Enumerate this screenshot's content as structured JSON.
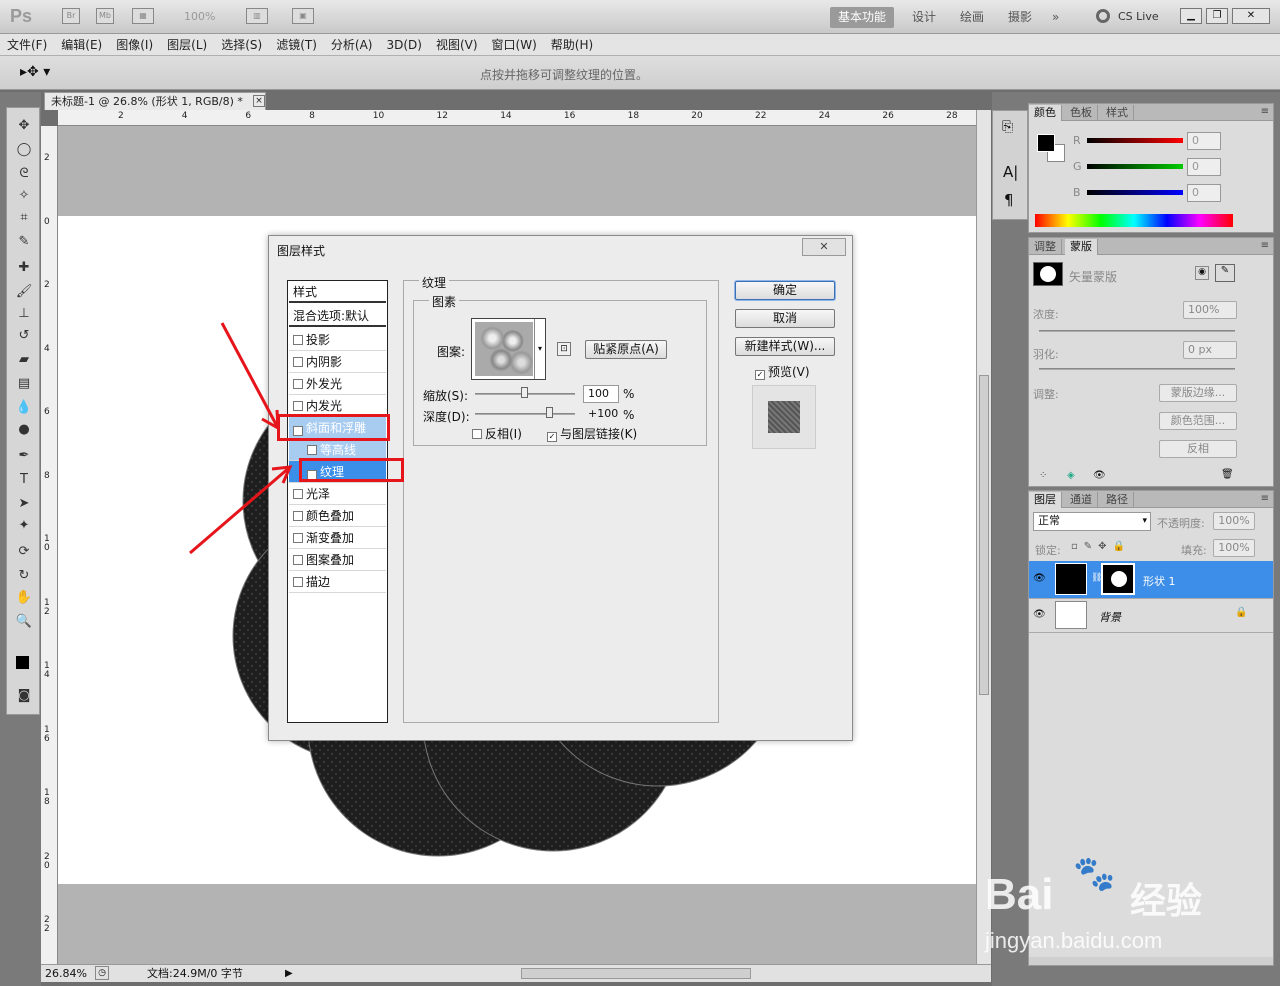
{
  "app": {
    "logo": "Ps",
    "zoom": "100%",
    "cs_live": "CS Live"
  },
  "workspaces": [
    "基本功能",
    "设计",
    "绘画",
    "摄影"
  ],
  "more_ws": "»",
  "menu": [
    "文件(F)",
    "编辑(E)",
    "图像(I)",
    "图层(L)",
    "选择(S)",
    "滤镜(T)",
    "分析(A)",
    "3D(D)",
    "视图(V)",
    "窗口(W)",
    "帮助(H)"
  ],
  "options": {
    "hint": "点按并拖移可调整纹理的位置。"
  },
  "document": {
    "tab_title": "未标题-1 @ 26.8% (形状 1, RGB/8) *",
    "close": "×"
  },
  "ruler": {
    "h_ticks": [
      "2",
      "4",
      "6",
      "8",
      "10",
      "12",
      "14",
      "16",
      "18",
      "20",
      "22",
      "24",
      "26",
      "28"
    ],
    "v_ticks": [
      "2",
      "0",
      "2",
      "4",
      "6",
      "8",
      "1\n0",
      "1\n2",
      "1\n4",
      "1\n6",
      "1\n8",
      "2\n0",
      "2\n2"
    ]
  },
  "status": {
    "zoom": "26.84%",
    "doc": "文档:24.9M/0 字节"
  },
  "dialog": {
    "title": "图层样式",
    "close": "✕",
    "styles_header": "样式",
    "blend_default": "混合选项:默认",
    "items": [
      {
        "label": "投影",
        "checked": false
      },
      {
        "label": "内阴影",
        "checked": false
      },
      {
        "label": "外发光",
        "checked": false
      },
      {
        "label": "内发光",
        "checked": false
      },
      {
        "label": "斜面和浮雕",
        "checked": true
      },
      {
        "label": "等高线",
        "checked": false
      },
      {
        "label": "纹理",
        "checked": true
      },
      {
        "label": "光泽",
        "checked": false
      },
      {
        "label": "颜色叠加",
        "checked": false
      },
      {
        "label": "渐变叠加",
        "checked": false
      },
      {
        "label": "图案叠加",
        "checked": false
      },
      {
        "label": "描边",
        "checked": false
      }
    ],
    "group_title": "纹理",
    "subgroup_title": "图素",
    "pattern_label": "图案:",
    "snap_button": "贴紧原点(A)",
    "scale_label": "缩放(S):",
    "scale_value": "100",
    "depth_label": "深度(D):",
    "depth_value": "+100",
    "percent": "%",
    "invert_label": "反相(I)",
    "link_label": "与图层链接(K)",
    "ok": "确定",
    "cancel": "取消",
    "new_style": "新建样式(W)...",
    "preview": "预览(V)"
  },
  "color_panel": {
    "tabs": [
      "颜色",
      "色板",
      "样式"
    ],
    "channels": [
      {
        "name": "R",
        "value": "0"
      },
      {
        "name": "G",
        "value": "0"
      },
      {
        "name": "B",
        "value": "0"
      }
    ]
  },
  "mask_panel": {
    "tabs": [
      "调整",
      "蒙版"
    ],
    "vector_mask": "矢量蒙版",
    "density_label": "浓度:",
    "density_value": "100%",
    "feather_label": "羽化:",
    "feather_value": "0 px",
    "adjust_label": "调整:",
    "mask_edge": "蒙版边缘...",
    "color_range": "颜色范围...",
    "invert": "反相"
  },
  "layers_panel": {
    "tabs": [
      "图层",
      "通道",
      "路径"
    ],
    "blend_mode": "正常",
    "opacity_label": "不透明度:",
    "opacity_value": "100%",
    "lock_label": "锁定:",
    "fill_label": "填充:",
    "fill_value": "100%",
    "layers": [
      {
        "name": "形状 1",
        "selected": true
      },
      {
        "name": "背景",
        "selected": false
      }
    ]
  },
  "watermark": {
    "text1": "Bai",
    "text2": "经验",
    "url": "jingyan.baidu.com"
  },
  "colors": {
    "accent": "#3b8fe8",
    "annotation": "#e5151b"
  }
}
